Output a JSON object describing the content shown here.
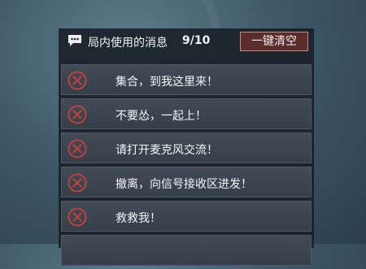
{
  "header": {
    "title": "局内使用的消息",
    "count": "9/10",
    "clear_label": "一键清空",
    "icon": "chat-bubble-icon"
  },
  "messages": [
    {
      "text": "集合，到我这里来！",
      "icon": "delete-icon"
    },
    {
      "text": "不要怂，一起上！",
      "icon": "delete-icon"
    },
    {
      "text": "请打开麦克风交流！",
      "icon": "delete-icon"
    },
    {
      "text": "撤离，向信号接收区进发！",
      "icon": "delete-icon"
    },
    {
      "text": "救救我！",
      "icon": "delete-icon"
    },
    {
      "text": "",
      "icon": "delete-icon"
    }
  ],
  "colors": {
    "accent_delete": "#c0413c",
    "clear_button_bg": "#5b2c2c",
    "clear_button_border": "#c98a86"
  }
}
